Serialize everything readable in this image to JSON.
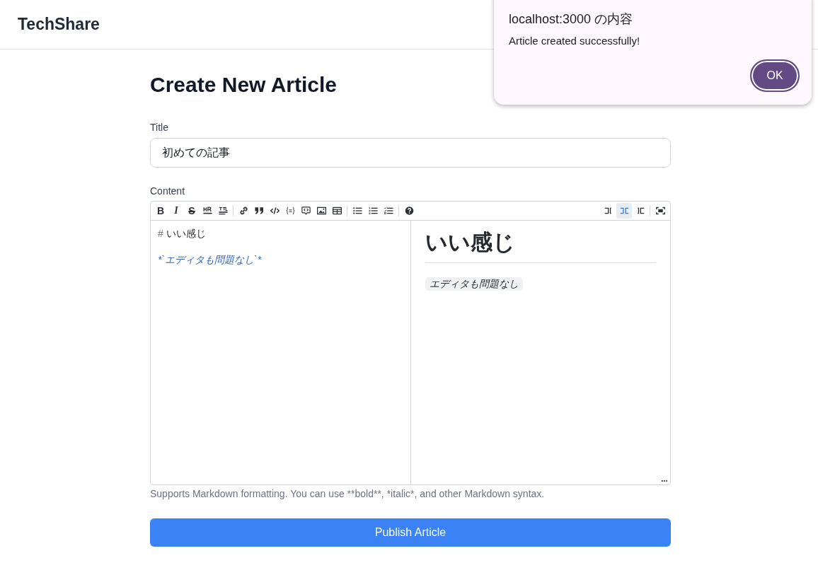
{
  "header": {
    "brand": "TechShare"
  },
  "page": {
    "title": "Create New Article"
  },
  "form": {
    "title_field": {
      "label": "Title",
      "value": "初めての記事"
    },
    "content_field": {
      "label": "Content",
      "toolbar": {
        "left": [
          [
            {
              "kind": "bold",
              "label": "B"
            },
            {
              "kind": "italic",
              "label": "I"
            },
            {
              "kind": "strikethrough",
              "label": "S"
            },
            {
              "kind": "hr"
            },
            {
              "kind": "title"
            }
          ],
          [
            {
              "kind": "link"
            },
            {
              "kind": "quote"
            },
            {
              "kind": "code"
            },
            {
              "kind": "braces"
            },
            {
              "kind": "code-bubble"
            },
            {
              "kind": "image"
            },
            {
              "kind": "table"
            }
          ],
          [
            {
              "kind": "bullet-list"
            },
            {
              "kind": "numbered-list"
            },
            {
              "kind": "checklist"
            }
          ],
          [
            {
              "kind": "help"
            }
          ]
        ],
        "view_modes": [
          {
            "kind": "split-left",
            "selected": false
          },
          {
            "kind": "split-view",
            "selected": true
          },
          {
            "kind": "split-right",
            "selected": false
          }
        ],
        "right": [
          {
            "kind": "fullscreen"
          }
        ]
      },
      "source_lines": [
        {
          "kind": "heading",
          "marker": "#",
          "text": "いい感じ"
        },
        {
          "kind": "emphasis",
          "text": "*`エディタも問題なし`*"
        }
      ],
      "preview": [
        {
          "kind": "heading",
          "text": "いい感じ"
        },
        {
          "kind": "inline-code",
          "text": "エディタも問題なし"
        }
      ]
    },
    "hint": "Supports Markdown formatting. You can use **bold**, *italic*, and other Markdown syntax.",
    "submit": "Publish Article"
  },
  "dialog": {
    "title": "localhost:3000 の内容",
    "message": "Article created successfully!",
    "button": "OK"
  }
}
